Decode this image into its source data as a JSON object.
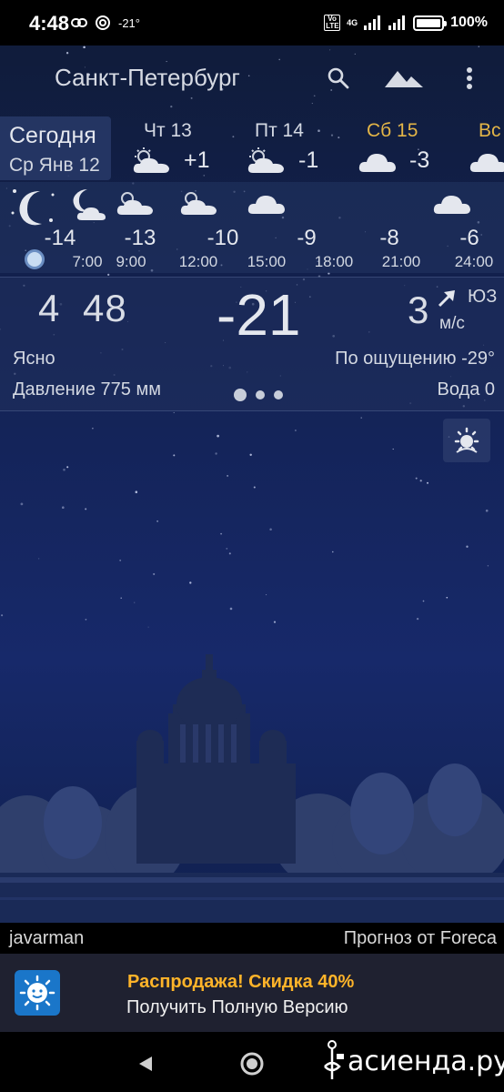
{
  "status_bar": {
    "time": "4:48",
    "temp": "-21°",
    "volte": "Vo LTE",
    "network": "4G",
    "battery": "100%",
    "battery_level": 1.0
  },
  "app_bar": {
    "city": "Санкт-Петербург",
    "icons": [
      "search-icon",
      "landscape-icon",
      "more-vert-icon"
    ]
  },
  "days": {
    "today_label": "Сегодня",
    "today_date": "Ср Янв 12",
    "items": [
      {
        "name": "Чт 13",
        "temp": "+1",
        "icon": "partly-cloudy-icon",
        "highlight": false
      },
      {
        "name": "Пт 14",
        "temp": "-1",
        "icon": "partly-cloudy-icon",
        "highlight": false
      },
      {
        "name": "Сб 15",
        "temp": "-3",
        "icon": "cloud-icon",
        "highlight": true
      },
      {
        "name": "Вс",
        "temp": "",
        "icon": "cloud-icon",
        "highlight": false
      }
    ]
  },
  "hourly": [
    {
      "temp": "-14",
      "time": "",
      "icon": "moon-stars-icon"
    },
    {
      "temp": "-13",
      "time": "7:00",
      "icon": "moon-cloud-icon"
    },
    {
      "temp": "-10",
      "time": "9:00",
      "icon": "cloud-icon"
    },
    {
      "temp": "-9",
      "time": "12:00",
      "icon": "partly-cloudy-icon"
    },
    {
      "temp": "-8",
      "time": "15:00",
      "icon": "cloud-icon"
    },
    {
      "temp": "-6",
      "time": "18:00",
      "icon": ""
    },
    {
      "temp": "",
      "time": "21:00",
      "icon": "cloud-icon"
    },
    {
      "temp": "",
      "time": "24:00",
      "icon": ""
    }
  ],
  "current": {
    "time": "4 48",
    "temp": "-21",
    "wind_speed": "3",
    "wind_dir": "ЮЗ",
    "wind_unit": "м/с",
    "condition": "Ясно",
    "feels_like": "По ощущению -29°",
    "pressure": "Давление 775 мм",
    "water": "Вода 0"
  },
  "footer": {
    "author": "javarman",
    "source": "Прогноз от Foreca"
  },
  "promo": {
    "sale": "Распродажа! Скидка 40%",
    "full_version": "Получить Полную Версию"
  },
  "watermark": "асиенда.ру",
  "colors": {
    "accent": "#ffb429",
    "sky_top": "#101c3b",
    "sky_bottom": "#17296a"
  }
}
